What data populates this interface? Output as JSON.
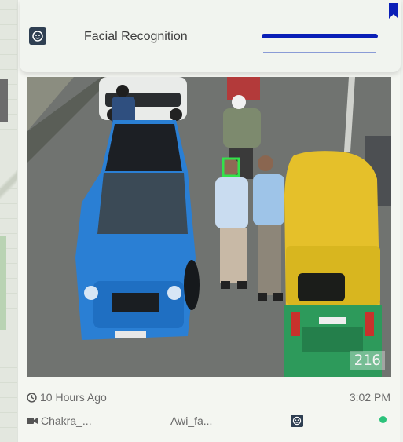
{
  "card": {
    "title": "Facial Recognition",
    "frame_counter": "216",
    "time_ago": "10 Hours Ago",
    "clock": "3:02 PM",
    "camera": "Chakra_...",
    "source": "Awi_fa..."
  },
  "icons": {
    "header": "face-icon",
    "bookmark": "bookmark-icon",
    "time": "clock-icon",
    "camera": "video-camera-icon",
    "status": "status-dot"
  },
  "colors": {
    "accent": "#0a1fb7",
    "status": "#2bc27a",
    "icon_bg": "#2f3f52"
  }
}
